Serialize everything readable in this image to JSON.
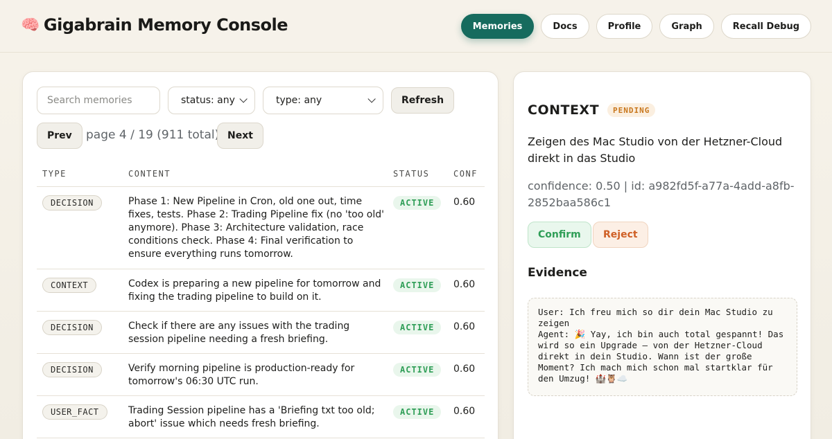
{
  "header": {
    "brand_icon": "🧠",
    "title": "Gigabrain Memory Console",
    "nav": [
      {
        "label": "Memories",
        "active": true
      },
      {
        "label": "Docs",
        "active": false
      },
      {
        "label": "Profile",
        "active": false
      },
      {
        "label": "Graph",
        "active": false
      },
      {
        "label": "Recall Debug",
        "active": false
      }
    ]
  },
  "filters": {
    "search_placeholder": "Search memories",
    "status_value": "status: any",
    "type_value": "type: any",
    "refresh_label": "Refresh"
  },
  "pagination": {
    "prev_label": "Prev",
    "next_label": "Next",
    "info": "page 4 / 19 (911 total)"
  },
  "table": {
    "headers": [
      "TYPE",
      "CONTENT",
      "STATUS",
      "CONF"
    ],
    "rows": [
      {
        "type": "DECISION",
        "content": "Phase 1: New Pipeline in Cron, old one out, time fixes, tests. Phase 2: Trading Pipeline fix (no 'too old' anymore). Phase 3: Architecture validation, race conditions check. Phase 4: Final verification to ensure everything runs tomorrow.",
        "status": "ACTIVE",
        "conf": "0.60"
      },
      {
        "type": "CONTEXT",
        "content": "Codex is preparing a new pipeline for tomorrow and fixing the trading pipeline to build on it.",
        "status": "ACTIVE",
        "conf": "0.60"
      },
      {
        "type": "DECISION",
        "content": "Check if there are any issues with the trading session pipeline needing a fresh briefing.",
        "status": "ACTIVE",
        "conf": "0.60"
      },
      {
        "type": "DECISION",
        "content": "Verify morning pipeline is production-ready for tomorrow's 06:30 UTC run.",
        "status": "ACTIVE",
        "conf": "0.60"
      },
      {
        "type": "USER_FACT",
        "content": "Trading Session pipeline has a 'Briefing txt too old; abort' issue which needs fresh briefing.",
        "status": "ACTIVE",
        "conf": "0.60"
      }
    ]
  },
  "detail": {
    "type": "CONTEXT",
    "badge": "PENDING",
    "content": "Zeigen des Mac Studio von der Hetzner-Cloud direkt in das Studio",
    "meta": "confidence: 0.50 | id: a982fd5f-a77a-4add-a8fb-2852baa586c1",
    "confirm_label": "Confirm",
    "reject_label": "Reject",
    "evidence_heading": "Evidence",
    "evidence_text": "User: Ich freu mich so dir dein Mac Studio zu zeigen\nAgent: 🎉 Yay, ich bin auch total gespannt! Das wird so ein Upgrade — von der Hetzner-Cloud direkt in dein Studio. Wann ist der große Moment? Ich mach mich schon mal startklar für den Umzug! 🏰🦉☁️"
  },
  "colors": {
    "accent": "#166b5e",
    "active_status": "#2f9e57",
    "pending_badge": "#c8761b",
    "reject": "#cf5f25"
  }
}
